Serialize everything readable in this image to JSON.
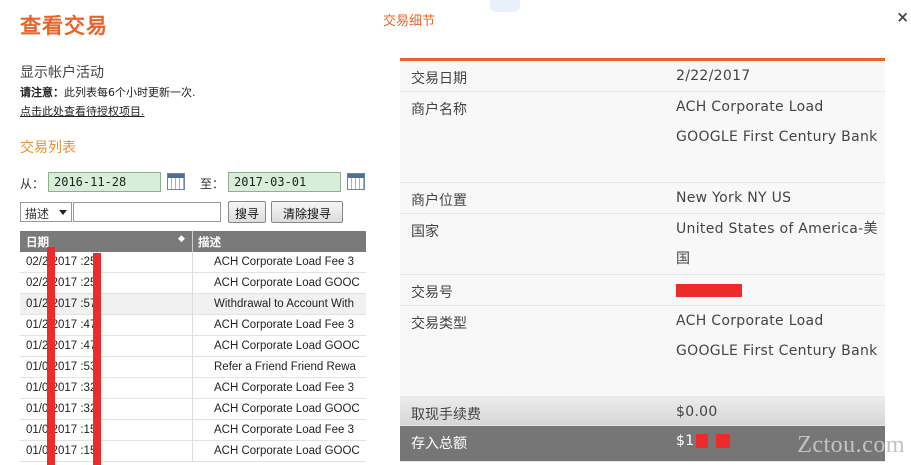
{
  "page": {
    "title": "查看交易",
    "section_title": "显示帐户活动",
    "notice_label": "请注意：",
    "notice_text": "此列表每6个小时更新一次.",
    "auth_link": "点击此处查看待授权项目.",
    "list_title": "交易列表"
  },
  "filters": {
    "from_label": "从：",
    "from_date": "2016-11-28",
    "to_label": "至：",
    "to_date": "2017-03-01",
    "field_select": "描述",
    "search_value": "",
    "search_button": "搜寻",
    "clear_button": "清除搜寻"
  },
  "table": {
    "headers": [
      "日期",
      "描述"
    ],
    "sort_indicator": "◆",
    "rows": [
      {
        "date": "02/2  2017   :25",
        "desc": "ACH Corporate Load Fee 3"
      },
      {
        "date": "02/2  2017   :25",
        "desc": "ACH Corporate Load GOOC"
      },
      {
        "date": "01/2  2017   :57",
        "desc": "Withdrawal to Account With"
      },
      {
        "date": "01/2  2017   :47",
        "desc": "ACH Corporate Load Fee 3"
      },
      {
        "date": "01/2  2017   :47",
        "desc": "ACH Corporate Load GOOC"
      },
      {
        "date": "01/0  2017   :53",
        "desc": "Refer a Friend Friend Rewa"
      },
      {
        "date": "01/0  2017   :32",
        "desc": "ACH Corporate Load Fee 3"
      },
      {
        "date": "01/0  2017   :32",
        "desc": "ACH Corporate Load GOOC"
      },
      {
        "date": "01/0  2017   :15",
        "desc": "ACH Corporate Load Fee 3"
      },
      {
        "date": "01/0  2017   :15",
        "desc": "ACH Corporate Load GOOC"
      }
    ]
  },
  "detail": {
    "title": "交易细节",
    "close": "×",
    "rows": [
      {
        "label": "交易日期",
        "value": "2/22/2017"
      },
      {
        "label": "商户名称",
        "value": "ACH Corporate Load GOOGLE First Century Bank"
      },
      {
        "label": "商户位置",
        "value": "New York NY US"
      },
      {
        "label": "国家",
        "value": "United States of America-美国"
      },
      {
        "label": "交易号",
        "value": ""
      },
      {
        "label": "交易类型",
        "value": "ACH Corporate Load GOOGLE First Century Bank"
      },
      {
        "label": "取现手续费",
        "value": "$0.00"
      },
      {
        "label": "存入总额",
        "value": "$1"
      }
    ]
  },
  "watermark": "Zctou.com",
  "colors": {
    "accent": "#e8652a",
    "header_gray": "#7a7a7a",
    "date_bg": "#d8eed8",
    "redaction": "#ee2b2b"
  }
}
